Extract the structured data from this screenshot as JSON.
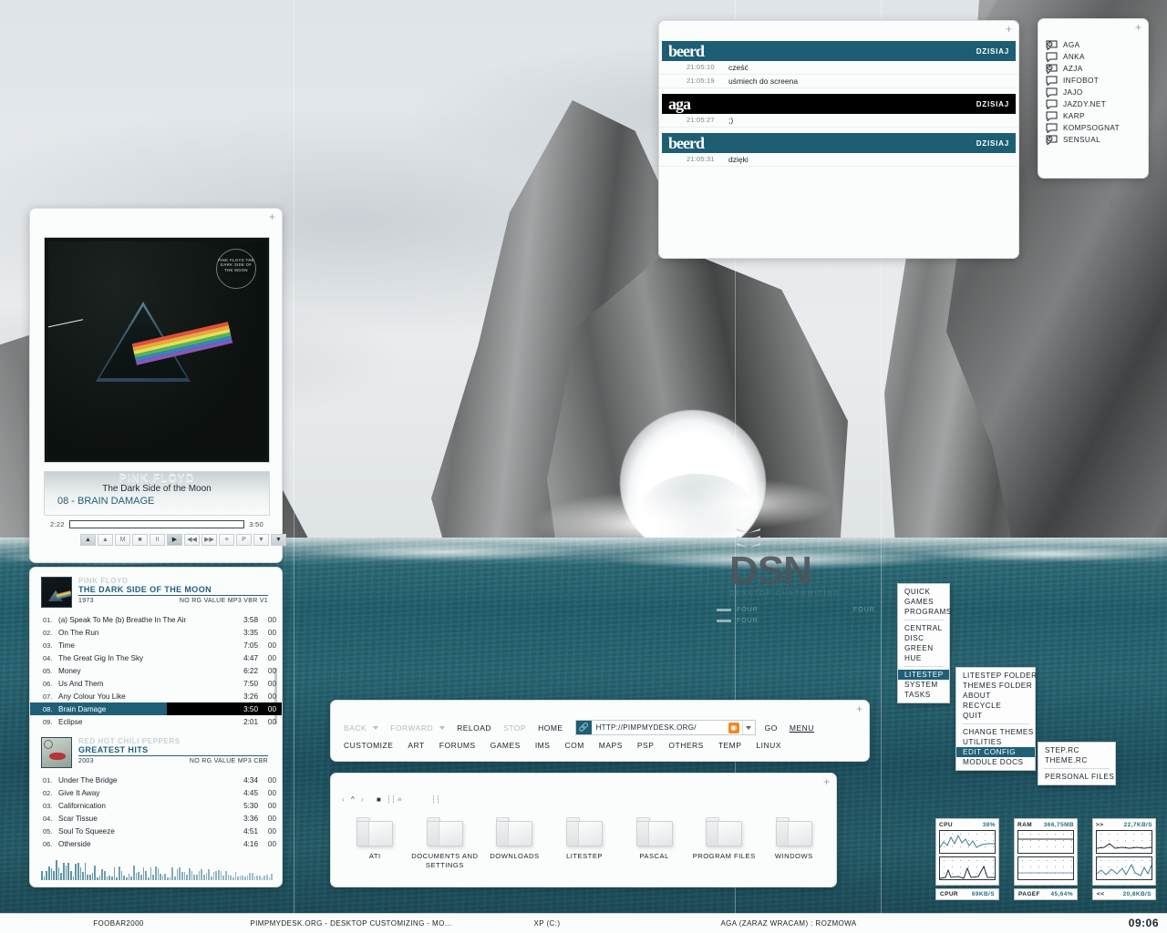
{
  "wallpaper": {
    "watermark": "DSN",
    "watermark_sub": "DESKTOP CUSTOMIZING",
    "four_label": "FOUR"
  },
  "player": {
    "album_art_stamp": "PINK FLOYD THE DARK SIDE OF THE MOON",
    "band": "PINK FLOYD",
    "album": "The Dark Side of the Moon",
    "track": "08 - BRAIN DAMAGE",
    "elapsed": "2:22",
    "total": "3:50",
    "buttons": [
      {
        "name": "open-button",
        "glyph": "▲",
        "style": "dk"
      },
      {
        "name": "up-button",
        "glyph": "▲",
        "style": ""
      },
      {
        "name": "mute-button",
        "glyph": "M",
        "style": ""
      },
      {
        "name": "stop-button",
        "glyph": "■",
        "style": ""
      },
      {
        "name": "pause-button",
        "glyph": "II",
        "style": ""
      },
      {
        "name": "play-button",
        "glyph": "▶",
        "style": "ac"
      },
      {
        "name": "previous-button",
        "glyph": "◀◀",
        "style": ""
      },
      {
        "name": "next-button",
        "glyph": "▶▶",
        "style": ""
      },
      {
        "name": "shuffle-button",
        "glyph": "≡",
        "style": ""
      },
      {
        "name": "playlist-button",
        "glyph": "P",
        "style": ""
      },
      {
        "name": "down-button",
        "glyph": "▼",
        "style": ""
      },
      {
        "name": "close-button",
        "glyph": "▼",
        "style": "dk"
      }
    ]
  },
  "playlist": {
    "albums": [
      {
        "artist": "PINK FLOYD",
        "title": "THE DARK SIDE OF THE MOON",
        "year": "1973",
        "rg": "NO RG VALUE",
        "format": "MP3 VBR V1",
        "tracks": [
          {
            "no": "01.",
            "name": "(a) Speak To Me (b) Breathe In The Air",
            "dur": "3:58",
            "xx": "00",
            "selected": false
          },
          {
            "no": "02.",
            "name": "On The Run",
            "dur": "3:35",
            "xx": "00",
            "selected": false
          },
          {
            "no": "03.",
            "name": "Time",
            "dur": "7:05",
            "xx": "00",
            "selected": false
          },
          {
            "no": "04.",
            "name": "The Great Gig In The Sky",
            "dur": "4:47",
            "xx": "00",
            "selected": false
          },
          {
            "no": "05.",
            "name": "Money",
            "dur": "6:22",
            "xx": "00",
            "selected": false
          },
          {
            "no": "06.",
            "name": "Us And Them",
            "dur": "7:50",
            "xx": "00",
            "selected": false
          },
          {
            "no": "07.",
            "name": "Any Colour You Like",
            "dur": "3:26",
            "xx": "00",
            "selected": false
          },
          {
            "no": "08.",
            "name": "Brain Damage",
            "dur": "3:50",
            "xx": "00",
            "selected": true
          },
          {
            "no": "09.",
            "name": "Eclipse",
            "dur": "2:01",
            "xx": "00",
            "selected": false
          }
        ]
      },
      {
        "artist": "RED HOT CHILI PEPPERS",
        "title": "GREATEST HITS",
        "year": "2003",
        "rg": "NO RG VALUE",
        "format": "MP3 CBR",
        "tracks": [
          {
            "no": "01.",
            "name": "Under The Bridge",
            "dur": "4:34",
            "xx": "00",
            "selected": false
          },
          {
            "no": "02.",
            "name": "Give It Away",
            "dur": "4:45",
            "xx": "00",
            "selected": false
          },
          {
            "no": "03.",
            "name": "Californication",
            "dur": "5:30",
            "xx": "00",
            "selected": false
          },
          {
            "no": "04.",
            "name": "Scar Tissue",
            "dur": "3:36",
            "xx": "00",
            "selected": false
          },
          {
            "no": "05.",
            "name": "Soul To Squeeze",
            "dur": "4:51",
            "xx": "00",
            "selected": false
          },
          {
            "no": "06.",
            "name": "Otherside",
            "dur": "4:16",
            "xx": "00",
            "selected": false
          }
        ]
      }
    ]
  },
  "chat": {
    "groups": [
      {
        "who": "beerd",
        "day": "DZISIAJ",
        "style": "teal",
        "lines": [
          {
            "ts": "21:05:10",
            "text": "cześć"
          },
          {
            "ts": "21:05:19",
            "text": "uśmiech do screena"
          }
        ]
      },
      {
        "who": "aga",
        "day": "DZISIAJ",
        "style": "blk",
        "lines": [
          {
            "ts": "21:05:27",
            "text": ";)"
          }
        ]
      },
      {
        "who": "beerd",
        "day": "DZISIAJ",
        "style": "teal",
        "lines": [
          {
            "ts": "21:05:31",
            "text": "dzięki"
          }
        ]
      }
    ]
  },
  "contacts": {
    "items": [
      {
        "name": "AGA",
        "state": "away"
      },
      {
        "name": "ANKA",
        "state": "online"
      },
      {
        "name": "AZJA",
        "state": "away"
      },
      {
        "name": "INFOBOT",
        "state": "online"
      },
      {
        "name": "JAJO",
        "state": "online"
      },
      {
        "name": "JAZDY.NET",
        "state": "online"
      },
      {
        "name": "KARP",
        "state": "online"
      },
      {
        "name": "KOMPSOGNAT",
        "state": "online"
      },
      {
        "name": "SENSUAL",
        "state": "away"
      }
    ]
  },
  "browser": {
    "back": "BACK",
    "forward": "FORWARD",
    "reload": "RELOAD",
    "stop": "STOP",
    "home": "HOME",
    "url": "HTTP://PIMPMYDESK.ORG/",
    "go": "GO",
    "menu": "MENU",
    "bookmarks": [
      "CUSTOMIZE",
      "ART",
      "FORUMS",
      "GAMES",
      "IMS",
      "COM",
      "MAPS",
      "PSP",
      "OTHERS",
      "TEMP",
      "LINUX"
    ]
  },
  "folders": {
    "items": [
      "ATI",
      "DOCUMENTS AND SETTINGS",
      "DOWNLOADS",
      "LITESTEP",
      "PASCAL",
      "PROGRAM FILES",
      "WINDOWS"
    ]
  },
  "menus": {
    "root": {
      "group1": [
        "QUICK",
        "GAMES",
        "PROGRAMS"
      ],
      "group2": [
        "CENTRAL",
        "DISC",
        "GREEN",
        "HUE"
      ],
      "group3": [
        {
          "label": "LITESTEP",
          "selected": true
        },
        {
          "label": "SYSTEM",
          "selected": false
        },
        {
          "label": "TASKS",
          "selected": false
        }
      ]
    },
    "litestep": {
      "group1": [
        "LITESTEP FOLDER",
        "THEMES FOLDER",
        "ABOUT",
        "RECYCLE",
        "QUIT"
      ],
      "group2": [
        {
          "label": "CHANGE THEMES",
          "selected": false
        },
        {
          "label": "UTILITIES",
          "selected": false
        },
        {
          "label": "EDIT CONFIG",
          "selected": true
        },
        {
          "label": "MODULE DOCS",
          "selected": false
        }
      ]
    },
    "editconfig": {
      "group1": [
        "STEP.RC",
        "THEME.RC"
      ],
      "group2": [
        "PERSONAL FILES"
      ]
    }
  },
  "monitors": [
    {
      "name": "cpu-monitor",
      "head_label": "CPU",
      "head_value": "38%",
      "foot_label": "CPUR",
      "foot_value": "69KB/S"
    },
    {
      "name": "ram-monitor",
      "head_label": "RAM",
      "head_value": "366,75MB",
      "foot_label": "PAGEF",
      "foot_value": "45,64%"
    },
    {
      "name": "network-monitor",
      "head_label": ">>",
      "head_value": "22,7KB/S",
      "foot_label": "<<",
      "foot_value": "20,8KB/S"
    }
  ],
  "taskbar": {
    "items": [
      "FOOBAR2000",
      "PIMPMYDESK.ORG - DESKTOP CUSTOMIZING - MO...",
      "XP (C:)",
      "AGA (ZARAZ WRACAM) : ROZMOWA"
    ],
    "clock": "09:06"
  },
  "colors": {
    "teal": "#1f6078",
    "teal_dark": "#1d5e75",
    "orange": "#ef8a22",
    "panel": "#fbfcfc"
  }
}
